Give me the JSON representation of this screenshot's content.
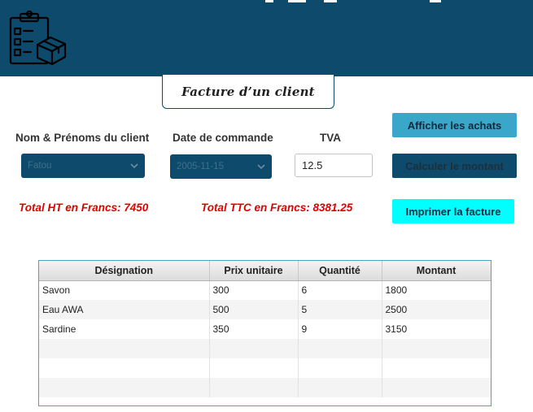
{
  "header": {
    "logo_icon": "clipboard-checklist-box-icon",
    "background": "#0e4a6c"
  },
  "title": "Facture d’un client",
  "labels": {
    "client": "Nom & Prénoms du client",
    "date": "Date de commande",
    "tva": "TVA"
  },
  "client_select": {
    "value": "Fatou"
  },
  "date_select": {
    "value": "2005-11-15"
  },
  "tva_input": {
    "value": "12.5"
  },
  "buttons": {
    "afficher": "Afficher les achats",
    "calculer": "Calculer le montant",
    "imprimer": "Imprimer la facture"
  },
  "totals": {
    "ht": "Total HT en Francs: 7450",
    "ttc": "Total TTC en Francs: 8381.25"
  },
  "table": {
    "columns": [
      "Désignation",
      "Prix unitaire",
      "Quantité",
      "Montant"
    ],
    "rows": [
      [
        "Savon",
        "300",
        "6",
        "1800"
      ],
      [
        "Eau AWA",
        "500",
        "5",
        "2500"
      ],
      [
        "Sardine",
        "350",
        "9",
        "3150"
      ]
    ]
  },
  "colors": {
    "primary": "#0e4a6c",
    "accent": "#3aa6c9",
    "cyan": "#00ffff",
    "total_red": "#e00000"
  }
}
